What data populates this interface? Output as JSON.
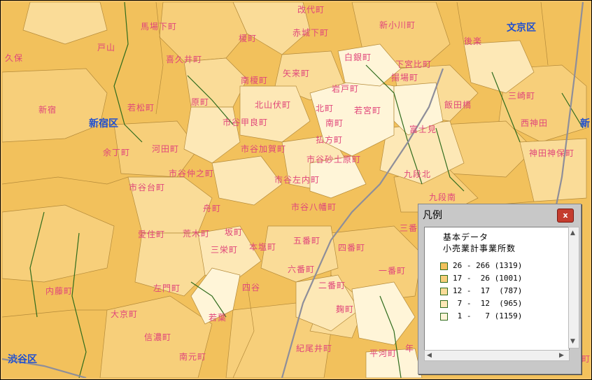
{
  "ward_labels": [
    {
      "id": "bunkyo",
      "text": "文京区"
    },
    {
      "id": "shinjuku",
      "text": "新宿区"
    },
    {
      "id": "shibuya",
      "text": "渋谷区"
    },
    {
      "id": "edge-right",
      "text": "新"
    }
  ],
  "town_labels": [
    {
      "id": "kaidaicho",
      "text": "改代町"
    },
    {
      "id": "shin-ogawa",
      "text": "新小川町"
    },
    {
      "id": "babashita",
      "text": "馬場下町"
    },
    {
      "id": "enoki",
      "text": "榎町"
    },
    {
      "id": "akagi-shita",
      "text": "赤城下町"
    },
    {
      "id": "koraku",
      "text": "後楽"
    },
    {
      "id": "toyama",
      "text": "戸山"
    },
    {
      "id": "okubo",
      "text": "久保"
    },
    {
      "id": "kikui",
      "text": "喜久井町"
    },
    {
      "id": "shirogane",
      "text": "白銀町"
    },
    {
      "id": "shimomiyabi",
      "text": "下宮比町"
    },
    {
      "id": "agebacho",
      "text": "揚場町"
    },
    {
      "id": "minami-enoki",
      "text": "南榎町"
    },
    {
      "id": "yarai",
      "text": "矢来町"
    },
    {
      "id": "iwato",
      "text": "岩戸町"
    },
    {
      "id": "shinjuku",
      "text": "新宿"
    },
    {
      "id": "wakamatsu",
      "text": "若松町"
    },
    {
      "id": "haramachi",
      "text": "原町"
    },
    {
      "id": "kitayamabushi",
      "text": "北山伏町"
    },
    {
      "id": "kitamachi",
      "text": "北町"
    },
    {
      "id": "wakamiya",
      "text": "若宮町"
    },
    {
      "id": "iidabashi",
      "text": "飯田橋"
    },
    {
      "id": "misaki",
      "text": "三崎町"
    },
    {
      "id": "ichigaya-kora",
      "text": "市谷甲良町"
    },
    {
      "id": "minamimachi",
      "text": "南町"
    },
    {
      "id": "fujimi",
      "text": "富士見"
    },
    {
      "id": "nishikanda",
      "text": "西神田"
    },
    {
      "id": "kinomaru",
      "text": "余丁町"
    },
    {
      "id": "kawada",
      "text": "河田町"
    },
    {
      "id": "ichigaya-kaga",
      "text": "市谷加賀町"
    },
    {
      "id": "haraikata",
      "text": "払方町"
    },
    {
      "id": "kanda-jimbo",
      "text": "神田神保町"
    },
    {
      "id": "ichigaya-sanaibara",
      "text": "市谷砂土原町"
    },
    {
      "id": "ichigaya-nakano",
      "text": "市谷仲之町"
    },
    {
      "id": "kudan-kita",
      "text": "九段北"
    },
    {
      "id": "ichigaya-sanai",
      "text": "市谷左内町"
    },
    {
      "id": "ichigaya-dai",
      "text": "市谷台町"
    },
    {
      "id": "kudan-minami",
      "text": "九段南"
    },
    {
      "id": "funamachi",
      "text": "舟町"
    },
    {
      "id": "ichigaya-hachiman",
      "text": "市谷八幡町"
    },
    {
      "id": "sanbancho",
      "text": "三番"
    },
    {
      "id": "aizumi",
      "text": "愛住町"
    },
    {
      "id": "araki",
      "text": "荒木町"
    },
    {
      "id": "sakamachi",
      "text": "坂町"
    },
    {
      "id": "gobancho",
      "text": "五番町"
    },
    {
      "id": "sanei",
      "text": "三栄町"
    },
    {
      "id": "honshio",
      "text": "本塩町"
    },
    {
      "id": "yonbancho",
      "text": "四番町"
    },
    {
      "id": "rokubancho",
      "text": "六番町"
    },
    {
      "id": "ichibancho",
      "text": "一番町"
    },
    {
      "id": "naitomachi",
      "text": "内藤町"
    },
    {
      "id": "samon",
      "text": "左門町"
    },
    {
      "id": "yotsuya",
      "text": "四谷"
    },
    {
      "id": "nibancho",
      "text": "二番町"
    },
    {
      "id": "daikyo",
      "text": "大京町"
    },
    {
      "id": "wakaba",
      "text": "若葉"
    },
    {
      "id": "kojimachi",
      "text": "麹町"
    },
    {
      "id": "shinanomachi",
      "text": "信濃町"
    },
    {
      "id": "kioi",
      "text": "紀尾井町"
    },
    {
      "id": "hirakawa",
      "text": "平河町"
    },
    {
      "id": "minamimoto",
      "text": "南元町"
    },
    {
      "id": "nen",
      "text": "年"
    },
    {
      "id": "edge-ju",
      "text": "町"
    }
  ],
  "legend": {
    "title": "凡例",
    "close_label": "x",
    "heading1": "基本データ",
    "heading2": "小売業計事業所数",
    "rows": [
      {
        "label": "26 - 266 (1319)",
        "color": "#f2c15c"
      },
      {
        "label": "17 -  26 (1001)",
        "color": "#f7cf7a"
      },
      {
        "label": "12 -  17  (787)",
        "color": "#fadc98"
      },
      {
        "label": " 7 -  12  (965)",
        "color": "#fde8b6"
      },
      {
        "label": " 1 -   7 (1159)",
        "color": "#fff5d8"
      }
    ],
    "scroll_up": "▲",
    "scroll_down": "▼",
    "scroll_left": "◀",
    "scroll_right": "▶"
  },
  "colors": {
    "class1": "#f2c15c",
    "class2": "#f7cf7a",
    "class3": "#fadc98",
    "class4": "#fde8b6",
    "class5": "#fff5d8",
    "boundary": "#b48a3a",
    "ward_boundary": "#2f6b1c",
    "road": "#8e8e9a",
    "town_label": "#e0457a",
    "ward_label": "#1f4fd0"
  }
}
